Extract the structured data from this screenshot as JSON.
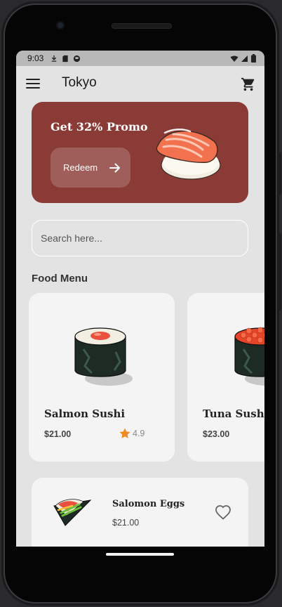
{
  "status_bar": {
    "time": "9:03"
  },
  "app_bar": {
    "title": "Tokyo"
  },
  "promo": {
    "title": "Get 32% Promo",
    "button_label": "Redeem"
  },
  "search": {
    "placeholder": "Search here..."
  },
  "section": {
    "title": "Food Menu"
  },
  "menu_cards": [
    {
      "name": "Salmon Sushi",
      "price": "$21.00",
      "rating": "4.9"
    },
    {
      "name": "Tuna Sushi",
      "price": "$23.00"
    }
  ],
  "list_items": [
    {
      "name": "Salomon Eggs",
      "price": "$21.00"
    }
  ],
  "colors": {
    "primary": "#8a3b36",
    "background": "#e3e3e3",
    "card": "#f4f4f4",
    "star": "#f08a24"
  },
  "icons": [
    "menu-icon",
    "cart-icon",
    "arrow-right-icon",
    "star-icon",
    "heart-outline-icon"
  ]
}
